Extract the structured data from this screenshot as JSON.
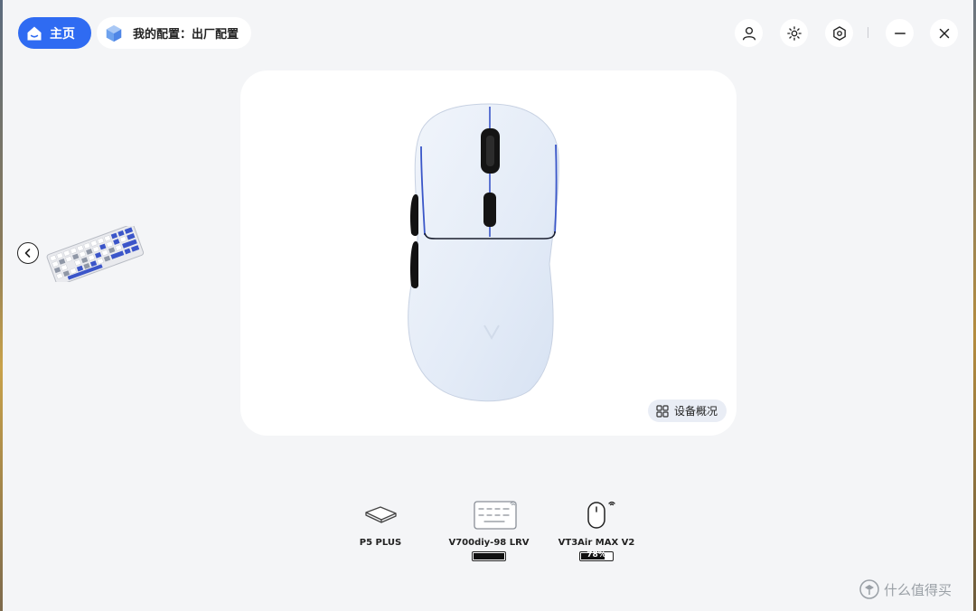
{
  "header": {
    "home_label": "主页",
    "config_label": "我的配置：出厂配置"
  },
  "window_controls": {
    "profile_icon": "user-icon",
    "lighting_icon": "sun-icon",
    "settings_icon": "hexagon-settings-icon",
    "minimize_icon": "minimize-icon",
    "close_icon": "close-icon"
  },
  "main": {
    "device_preview": "mouse",
    "overview_label": "设备概况"
  },
  "devices": [
    {
      "name": "P5 PLUS",
      "icon": "mousepad-icon",
      "wireless": false
    },
    {
      "name": "V700diy-98 LRV",
      "icon": "keyboard-icon",
      "wireless": true,
      "battery_percent": 100,
      "battery_label": ""
    },
    {
      "name": "VT3Air MAX V2",
      "icon": "mouse-icon",
      "wireless": true,
      "battery_percent": 78,
      "battery_label": "78%"
    }
  ],
  "watermark": {
    "text": "什么值得买"
  },
  "colors": {
    "accent": "#2f6bf2",
    "background": "#f4f5f7",
    "card": "#ffffff",
    "mouse_body": "#e6eef8",
    "mouse_trim": "#3a56c8"
  }
}
